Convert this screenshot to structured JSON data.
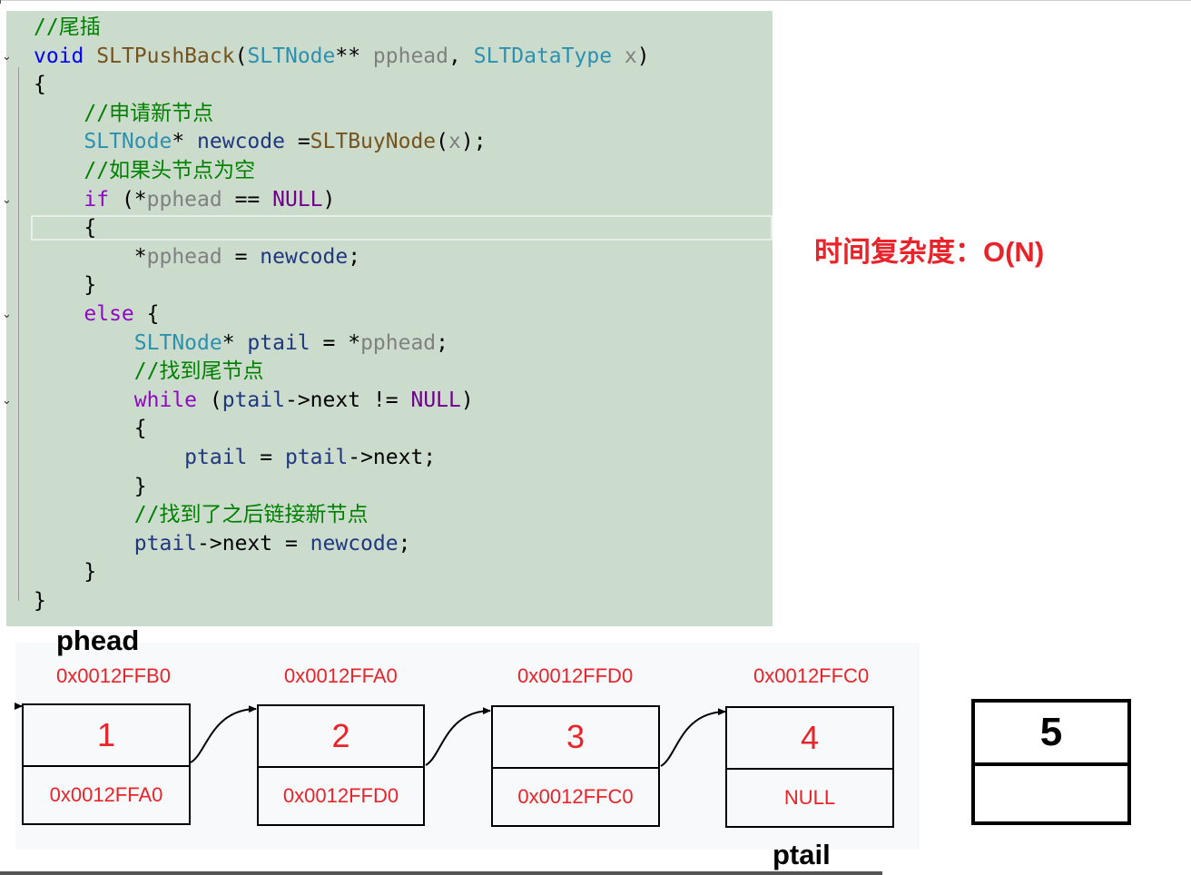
{
  "code": {
    "lines": [
      {
        "fold": "",
        "segs": [
          {
            "c": "cm",
            "t": "//尾插"
          }
        ]
      },
      {
        "fold": "v",
        "segs": [
          {
            "c": "kw",
            "t": "void"
          },
          {
            "c": "pl",
            "t": " "
          },
          {
            "c": "fn",
            "t": "SLTPushBack"
          },
          {
            "c": "pl",
            "t": "("
          },
          {
            "c": "ty",
            "t": "SLTNode"
          },
          {
            "c": "pl",
            "t": "** "
          },
          {
            "c": "par",
            "t": "pphead"
          },
          {
            "c": "pl",
            "t": ", "
          },
          {
            "c": "ty",
            "t": "SLTDataType"
          },
          {
            "c": "pl",
            "t": " "
          },
          {
            "c": "par",
            "t": "x"
          },
          {
            "c": "pl",
            "t": ")"
          }
        ]
      },
      {
        "fold": "",
        "segs": [
          {
            "c": "pl",
            "t": "{"
          }
        ]
      },
      {
        "fold": "",
        "segs": [
          {
            "c": "pl",
            "t": "    "
          },
          {
            "c": "cm",
            "t": "//申请新节点"
          }
        ]
      },
      {
        "fold": "",
        "segs": [
          {
            "c": "pl",
            "t": "    "
          },
          {
            "c": "ty",
            "t": "SLTNode"
          },
          {
            "c": "pl",
            "t": "* "
          },
          {
            "c": "var",
            "t": "newcode"
          },
          {
            "c": "pl",
            "t": " ="
          },
          {
            "c": "fn",
            "t": "SLTBuyNode"
          },
          {
            "c": "pl",
            "t": "("
          },
          {
            "c": "par",
            "t": "x"
          },
          {
            "c": "pl",
            "t": ");"
          }
        ]
      },
      {
        "fold": "",
        "segs": [
          {
            "c": "pl",
            "t": "    "
          },
          {
            "c": "cm",
            "t": "//如果头节点为空"
          }
        ]
      },
      {
        "fold": "v",
        "segs": [
          {
            "c": "pl",
            "t": "    "
          },
          {
            "c": "ctl",
            "t": "if"
          },
          {
            "c": "pl",
            "t": " (*"
          },
          {
            "c": "par",
            "t": "pphead"
          },
          {
            "c": "pl",
            "t": " == "
          },
          {
            "c": "mac",
            "t": "NULL"
          },
          {
            "c": "pl",
            "t": ")"
          }
        ]
      },
      {
        "fold": "",
        "segs": [
          {
            "c": "pl",
            "t": "    {"
          }
        ]
      },
      {
        "fold": "",
        "segs": [
          {
            "c": "pl",
            "t": "        *"
          },
          {
            "c": "par",
            "t": "pphead"
          },
          {
            "c": "pl",
            "t": " = "
          },
          {
            "c": "var",
            "t": "newcode"
          },
          {
            "c": "pl",
            "t": ";"
          }
        ]
      },
      {
        "fold": "",
        "segs": [
          {
            "c": "pl",
            "t": "    }"
          }
        ]
      },
      {
        "fold": "v",
        "segs": [
          {
            "c": "pl",
            "t": "    "
          },
          {
            "c": "ctl",
            "t": "else"
          },
          {
            "c": "pl",
            "t": " {"
          }
        ]
      },
      {
        "fold": "",
        "segs": [
          {
            "c": "pl",
            "t": "        "
          },
          {
            "c": "ty",
            "t": "SLTNode"
          },
          {
            "c": "pl",
            "t": "* "
          },
          {
            "c": "var",
            "t": "ptail"
          },
          {
            "c": "pl",
            "t": " = *"
          },
          {
            "c": "par",
            "t": "pphead"
          },
          {
            "c": "pl",
            "t": ";"
          }
        ]
      },
      {
        "fold": "",
        "segs": [
          {
            "c": "pl",
            "t": "        "
          },
          {
            "c": "cm",
            "t": "//找到尾节点"
          }
        ]
      },
      {
        "fold": "v",
        "segs": [
          {
            "c": "pl",
            "t": "        "
          },
          {
            "c": "ctl",
            "t": "while"
          },
          {
            "c": "pl",
            "t": " ("
          },
          {
            "c": "var",
            "t": "ptail"
          },
          {
            "c": "pl",
            "t": "->next != "
          },
          {
            "c": "mac",
            "t": "NULL"
          },
          {
            "c": "pl",
            "t": ")"
          }
        ]
      },
      {
        "fold": "",
        "segs": [
          {
            "c": "pl",
            "t": "        {"
          }
        ]
      },
      {
        "fold": "",
        "segs": [
          {
            "c": "pl",
            "t": "            "
          },
          {
            "c": "var",
            "t": "ptail"
          },
          {
            "c": "pl",
            "t": " = "
          },
          {
            "c": "var",
            "t": "ptail"
          },
          {
            "c": "pl",
            "t": "->next;"
          }
        ]
      },
      {
        "fold": "",
        "segs": [
          {
            "c": "pl",
            "t": "        }"
          }
        ]
      },
      {
        "fold": "",
        "segs": [
          {
            "c": "pl",
            "t": "        "
          },
          {
            "c": "cm",
            "t": "//找到了之后链接新节点"
          }
        ]
      },
      {
        "fold": "",
        "segs": [
          {
            "c": "pl",
            "t": "        "
          },
          {
            "c": "var",
            "t": "ptail"
          },
          {
            "c": "pl",
            "t": "->next = "
          },
          {
            "c": "var",
            "t": "newcode"
          },
          {
            "c": "pl",
            "t": ";"
          }
        ]
      },
      {
        "fold": "",
        "segs": [
          {
            "c": "pl",
            "t": "    }"
          }
        ]
      },
      {
        "fold": "",
        "segs": [
          {
            "c": "pl",
            "t": "}"
          }
        ]
      }
    ]
  },
  "complexity_label": "时间复杂度：O(N)",
  "diagram": {
    "phead_label": "phead",
    "ptail_label": "ptail",
    "nodes": [
      {
        "address": "0x0012FFB0",
        "data": "1",
        "next": "0x0012FFA0"
      },
      {
        "address": "0x0012FFA0",
        "data": "2",
        "next": "0x0012FFD0"
      },
      {
        "address": "0x0012FFD0",
        "data": "3",
        "next": "0x0012FFC0"
      },
      {
        "address": "0x0012FFC0",
        "data": "4",
        "next": "NULL"
      }
    ],
    "new_node": {
      "data": "5",
      "next": ""
    }
  }
}
